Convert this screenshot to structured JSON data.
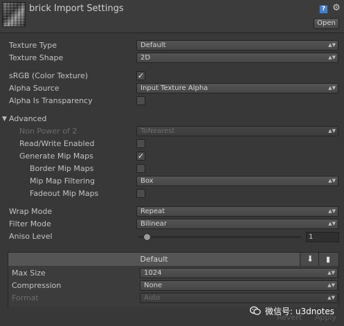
{
  "header": {
    "title": "brick Import Settings",
    "open_label": "Open"
  },
  "fields": {
    "texture_type": {
      "label": "Texture Type",
      "value": "Default"
    },
    "texture_shape": {
      "label": "Texture Shape",
      "value": "2D"
    },
    "srgb": {
      "label": "sRGB (Color Texture)",
      "checked": true
    },
    "alpha_source": {
      "label": "Alpha Source",
      "value": "Input Texture Alpha"
    },
    "alpha_transparency": {
      "label": "Alpha Is Transparency",
      "checked": false
    }
  },
  "advanced": {
    "label": "Advanced",
    "non_power_of_2": {
      "label": "Non Power of 2",
      "value": "ToNearest"
    },
    "read_write": {
      "label": "Read/Write Enabled",
      "checked": false
    },
    "generate_mip_maps": {
      "label": "Generate Mip Maps",
      "checked": true
    },
    "border_mip_maps": {
      "label": "Border Mip Maps",
      "checked": false
    },
    "mip_map_filtering": {
      "label": "Mip Map Filtering",
      "value": "Box"
    },
    "fadeout_mip_maps": {
      "label": "Fadeout Mip Maps",
      "checked": false
    }
  },
  "wrap": {
    "wrap_mode": {
      "label": "Wrap Mode",
      "value": "Repeat"
    },
    "filter_mode": {
      "label": "Filter Mode",
      "value": "Bilinear"
    },
    "aniso_level": {
      "label": "Aniso Level",
      "value": "1"
    }
  },
  "platform": {
    "tab_label": "Default",
    "max_size": {
      "label": "Max Size",
      "value": "1024"
    },
    "compression": {
      "label": "Compression",
      "value": "None"
    },
    "format": {
      "label": "Format",
      "value": "Auto"
    }
  },
  "footer": {
    "revert_label": "Revert",
    "apply_label": "Apply"
  },
  "watermark": {
    "text": "微信号: u3dnotes"
  },
  "icons": {
    "check": "✓",
    "dropdown_arrow": "▲▼"
  }
}
